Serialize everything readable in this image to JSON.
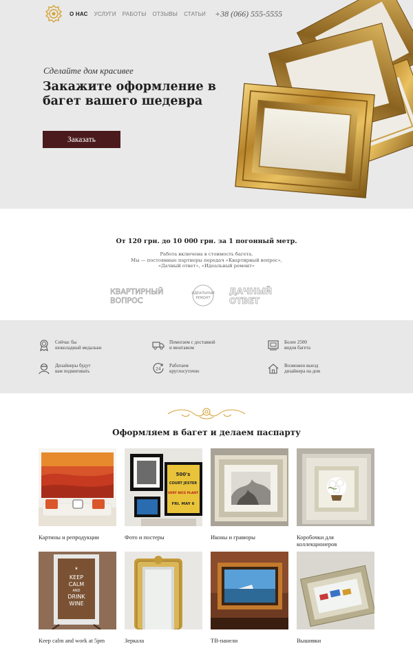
{
  "header": {
    "nav": [
      {
        "label": "О НАС",
        "active": true
      },
      {
        "label": "УСЛУГИ",
        "active": false
      },
      {
        "label": "РАБОТЫ",
        "active": false
      },
      {
        "label": "ОТЗЫВЫ",
        "active": false
      },
      {
        "label": "СТАТЬИ",
        "active": false
      }
    ],
    "phone": "+38 (066) 555-5555"
  },
  "hero": {
    "tagline": "Сделайте дом красивее",
    "title": "Закажите оформление в багет вашего шедевра",
    "cta": "Заказать"
  },
  "price": {
    "headline": "От 120 грн. до 10 000 грн. за 1 погонный метр.",
    "line1": "Работа включена в стоимость багета.",
    "line2": "Мы — постоянные партнеры передач «Квартирный вопрос»,",
    "line3": "«Дачный ответ», «Идеальный ремонт»",
    "partners": [
      {
        "name": "квартирный вопрос",
        "l1": "КВАРТИРНЫЙ",
        "l2": "ВОПРОС"
      },
      {
        "name": "идеальный ремонт",
        "l1": "ИДЕАЛЬНЫЙ",
        "l2": "РЕМОНТ"
      },
      {
        "name": "дачный ответ",
        "l1": "ДАЧНЫЙ",
        "l2": "ОТВЕТ"
      }
    ]
  },
  "features": [
    {
      "icon": "medal-icon",
      "line1": "Сейчас бы",
      "line2": "шоколадный медальки"
    },
    {
      "icon": "truck-icon",
      "line1": "Помогаем с доставкой",
      "line2": "и монтажом"
    },
    {
      "icon": "frames-icon",
      "line1": "Более 2500",
      "line2": "видов багета"
    },
    {
      "icon": "designer-icon",
      "line1": "Дизайнеры будут",
      "line2": "вам подмигивать"
    },
    {
      "icon": "clock-24-icon",
      "line1": "Работаем",
      "line2": "круглосуточно"
    },
    {
      "icon": "house-icon",
      "line1": "Возможен выезд",
      "line2": "дизайнера на дом"
    }
  ],
  "gallery": {
    "title": "Оформляем в багет и делаем паспарту",
    "items": [
      {
        "label": "Картины и репродукции"
      },
      {
        "label": "Фото и постеры"
      },
      {
        "label": "Иконы и гравюры"
      },
      {
        "label": "Коробочки для коллекционеров"
      },
      {
        "label": "Keep calm and work at 5pm"
      },
      {
        "label": "Зеркала"
      },
      {
        "label": "ТВ-панели"
      },
      {
        "label": "Вышивки"
      }
    ],
    "poster_texts": {
      "p1": "500's",
      "p2": "COURT JESTER",
      "p3": "VERY NICE PLANT",
      "p4": "FRI. MAY 6",
      "keep1": "KEEP",
      "keep2": "CALM",
      "keep3": "AND",
      "keep4": "DRINK",
      "keep5": "WINE"
    }
  },
  "colors": {
    "accent": "#4a1a1c",
    "gold": "#c9962a",
    "hero_bg": "#e9e9ea",
    "features_bg": "#e8e8e9"
  }
}
